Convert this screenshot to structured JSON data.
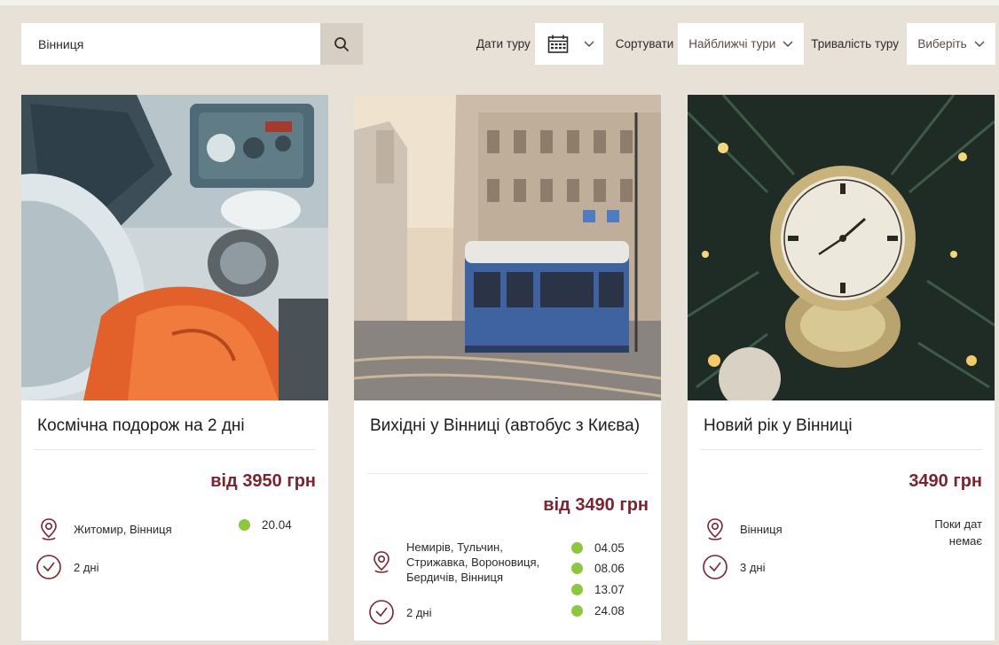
{
  "filters": {
    "search_value": "Вінниця",
    "search_placeholder": "Вінниця",
    "dates_label": "Дати туру",
    "sort_label": "Сортувати",
    "sort_value": "Найближчі тури",
    "duration_label": "Тривалість туру",
    "duration_value": "Виберіть"
  },
  "colors": {
    "accent": "#7a2430",
    "background": "#e8e1d8",
    "dot": "#8dc63f"
  },
  "cards": [
    {
      "title": "Космічна подорож на 2 дні",
      "price_prefix": "від",
      "price": "3950 грн",
      "location": "Житомир, Вінниця",
      "duration": "2 дні",
      "dates": [
        "20.04"
      ]
    },
    {
      "title": "Вихідні у Вінниці (автобус з Києва)",
      "price_prefix": "від",
      "price": "3490 грн",
      "location_lines": [
        "Немирів, Тульчин,",
        "Стрижавка, Вороновиця,",
        "Бердичів, Вінниця"
      ],
      "duration": "2 дні",
      "dates": [
        "04.05",
        "08.06",
        "13.07",
        "24.08"
      ]
    },
    {
      "title": "Новий рік у Вінниці",
      "price": "3490 грн",
      "location": "Вінниця",
      "duration": "3 дні",
      "no_dates_lines": [
        "Поки дат",
        "немає"
      ]
    }
  ]
}
